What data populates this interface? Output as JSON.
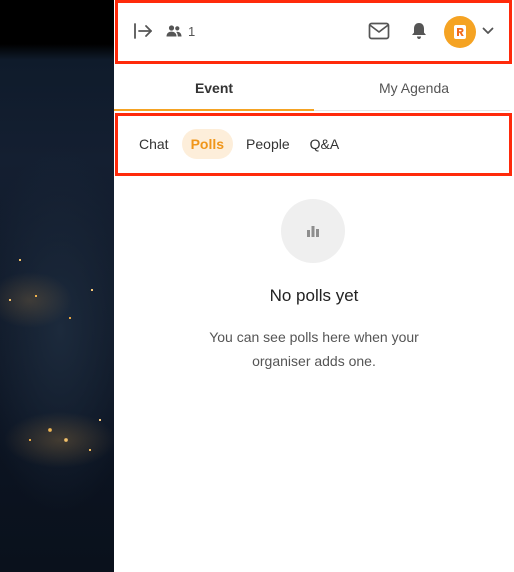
{
  "header": {
    "attendee_count": "1",
    "icons": {
      "leave": "leave-event-icon",
      "people": "people-icon",
      "mail": "mail-icon",
      "bell": "bell-icon",
      "avatar": "user-avatar-logo",
      "chevron": "chevron-down-icon"
    },
    "accent_color": "#f5a323",
    "highlight_color": "#ff2a0b"
  },
  "tabs": [
    {
      "label": "Event",
      "active": true
    },
    {
      "label": "My Agenda",
      "active": false
    }
  ],
  "subtabs": [
    {
      "label": "Chat",
      "active": false
    },
    {
      "label": "Polls",
      "active": true
    },
    {
      "label": "People",
      "active": false
    },
    {
      "label": "Q&A",
      "active": false
    }
  ],
  "empty_state": {
    "icon": "bar-chart-icon",
    "title": "No polls yet",
    "message": "You can see polls here when your organiser adds one."
  }
}
